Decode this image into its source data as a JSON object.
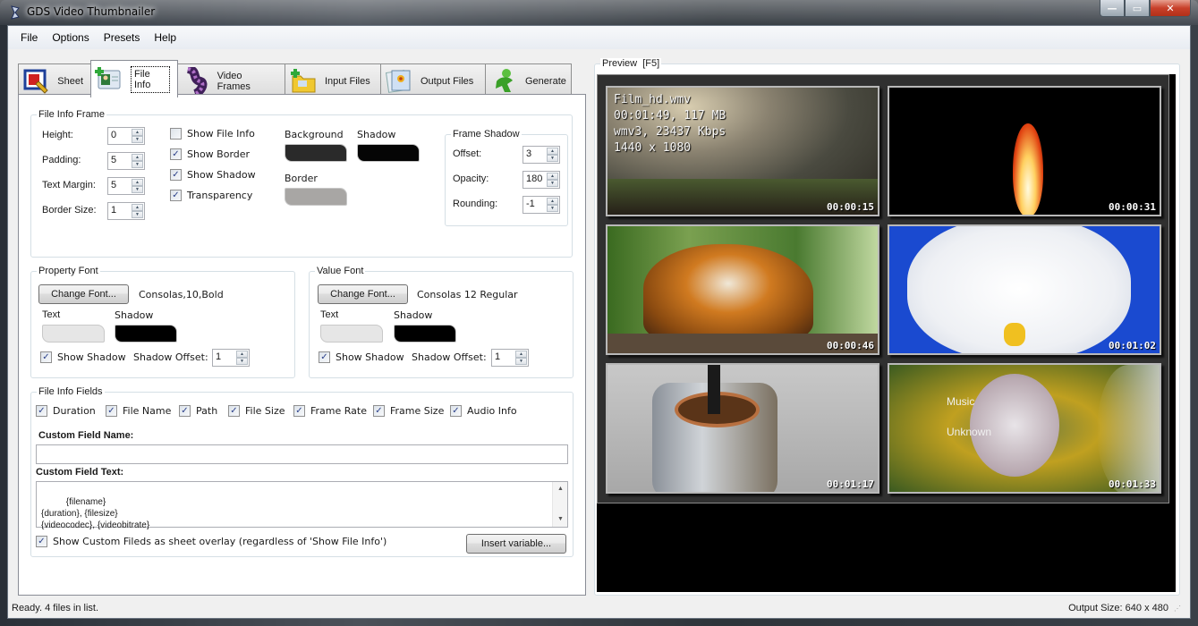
{
  "window": {
    "title": "GDS Video Thumbnailer",
    "controls": {
      "minimize": "—",
      "maximize": "▭",
      "close": "✕"
    }
  },
  "menu": [
    "File",
    "Options",
    "Presets",
    "Help"
  ],
  "tabs": [
    {
      "label": "Sheet",
      "icon": "sheet-icon"
    },
    {
      "label": "File Info",
      "icon": "file-info-icon",
      "active": true
    },
    {
      "label": "Video Frames",
      "icon": "film-strip-icon"
    },
    {
      "label": "Input Files",
      "icon": "folder-add-icon"
    },
    {
      "label": "Output Files",
      "icon": "picture-icon"
    },
    {
      "label": "Generate",
      "icon": "run-person-icon"
    }
  ],
  "file_info_frame": {
    "legend": "File Info Frame",
    "height": {
      "label": "Height:",
      "value": "0"
    },
    "padding": {
      "label": "Padding:",
      "value": "5"
    },
    "text_margin": {
      "label": "Text Margin:",
      "value": "5"
    },
    "border_size": {
      "label": "Border Size:",
      "value": "1"
    },
    "show_file_info": {
      "label": "Show File Info",
      "checked": false
    },
    "show_border": {
      "label": "Show Border",
      "checked": true
    },
    "show_shadow": {
      "label": "Show Shadow",
      "checked": true
    },
    "transparency": {
      "label": "Transparency",
      "checked": true
    },
    "background": {
      "label": "Background",
      "color": "#2a2a2a"
    },
    "shadow": {
      "label": "Shadow",
      "color": "#050505"
    },
    "border": {
      "label": "Border",
      "color": "#a8a6a4"
    }
  },
  "frame_shadow": {
    "legend": "Frame Shadow",
    "offset": {
      "label": "Offset:",
      "value": "3"
    },
    "opacity": {
      "label": "Opacity:",
      "value": "180"
    },
    "rounding": {
      "label": "Rounding:",
      "value": "-1"
    }
  },
  "property_font": {
    "legend": "Property Font",
    "change_button": "Change Font...",
    "font_name": "Consolas,10,Bold",
    "text": {
      "label": "Text",
      "color": "#e6e6e6"
    },
    "shadow": {
      "label": "Shadow",
      "color": "#000000"
    },
    "show_shadow": {
      "label": "Show Shadow",
      "checked": true
    },
    "shadow_offset": {
      "label": "Shadow Offset:",
      "value": "1"
    }
  },
  "value_font": {
    "legend": "Value Font",
    "change_button": "Change Font...",
    "font_name": "Consolas 12 Regular",
    "text": {
      "label": "Text",
      "color": "#e6e6e6"
    },
    "shadow": {
      "label": "Shadow",
      "color": "#000000"
    },
    "show_shadow": {
      "label": "Show Shadow",
      "checked": true
    },
    "shadow_offset": {
      "label": "Shadow Offset:",
      "value": "1"
    }
  },
  "file_info_fields": {
    "legend": "File Info Fields",
    "fields": [
      {
        "label": "Duration",
        "checked": true
      },
      {
        "label": "File Name",
        "checked": true
      },
      {
        "label": "Path",
        "checked": true
      },
      {
        "label": "File Size",
        "checked": true
      },
      {
        "label": "Frame Rate",
        "checked": true
      },
      {
        "label": "Frame Size",
        "checked": true
      },
      {
        "label": "Audio Info",
        "checked": true
      }
    ],
    "custom_field_name_label": "Custom Field Name:",
    "custom_field_name_value": "",
    "custom_field_text_label": "Custom Field Text:",
    "custom_field_text_value": "{filename}\n{duration}, {filesize}\n{videocodec}, {videobitrate}",
    "overlay": {
      "label": "Show Custom Fileds as sheet overlay (regardless of 'Show File Info')",
      "checked": true
    },
    "insert_variable_button": "Insert variable..."
  },
  "preview": {
    "legend": "Preview  [F5]",
    "info_overlay": "Film_hd.wmv\n00:01:49, 117 MB\nwmv3, 23437 Kbps\n1440 x 1080",
    "thumbnails": [
      {
        "timestamp": "00:00:15",
        "scene": "hazy-bicycle-scene"
      },
      {
        "timestamp": "00:00:31",
        "scene": "flame-scene"
      },
      {
        "timestamp": "00:00:46",
        "scene": "tiger-scene"
      },
      {
        "timestamp": "00:01:02",
        "scene": "orchid-scene"
      },
      {
        "timestamp": "00:01:17",
        "scene": "rusty-can-scene"
      },
      {
        "timestamp": "00:01:33",
        "scene": "dandelion-scene",
        "overlay_lines": [
          "Music",
          "Unknown"
        ]
      }
    ]
  },
  "status": {
    "left": "Ready. 4 files in list.",
    "right": "Output Size: 640 x 480"
  }
}
